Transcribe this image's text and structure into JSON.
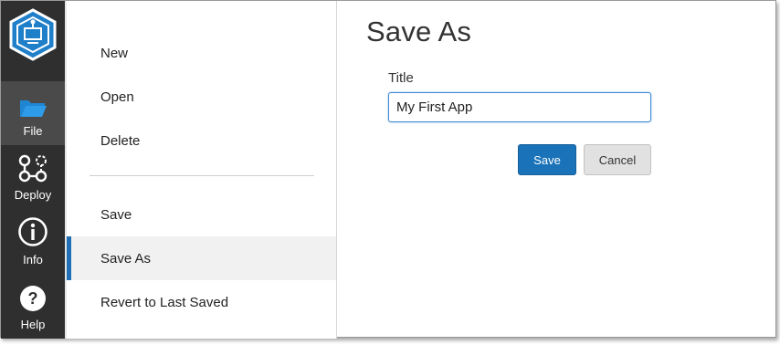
{
  "rail": {
    "items": [
      {
        "label": "File",
        "icon": "folder-icon"
      },
      {
        "label": "Deploy",
        "icon": "deploy-icon"
      },
      {
        "label": "Info",
        "icon": "info-icon"
      },
      {
        "label": "Help",
        "icon": "help-icon"
      }
    ],
    "active": "File"
  },
  "menu": {
    "items": [
      {
        "label": "New"
      },
      {
        "label": "Open"
      },
      {
        "label": "Delete"
      },
      {
        "label": "Save"
      },
      {
        "label": "Save As"
      },
      {
        "label": "Revert to Last Saved"
      }
    ],
    "selected": "Save As"
  },
  "main": {
    "title": "Save As",
    "field_label": "Title",
    "title_value": "My First App",
    "save_label": "Save",
    "cancel_label": "Cancel"
  },
  "colors": {
    "rail_bg": "#2f2f2f",
    "accent": "#1f6fb6",
    "logo": "#1f7fc9"
  }
}
